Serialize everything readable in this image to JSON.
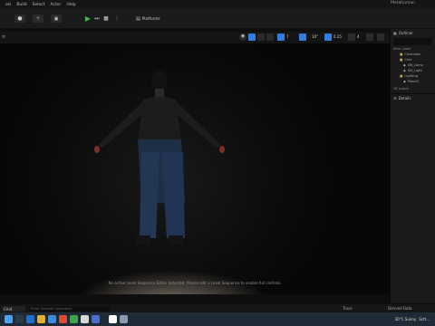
{
  "menu": {
    "items": [
      "ols",
      "Build",
      "Select",
      "Actor",
      "Help"
    ],
    "title": "Metahuman"
  },
  "toolbar": {
    "platforms_label": "Platforms"
  },
  "viewport": {
    "stats": [
      "7",
      "0.25",
      "4"
    ],
    "hint": "No active Level Sequence Editor detected. Please edit a Level Sequence to enable full controls."
  },
  "outliner": {
    "title": "Outliner",
    "column_label": "Item Label",
    "items": [
      "Cinematic",
      "Cine",
      "SM_Lamp",
      "SM_Light",
      "Lighting",
      "Plane3"
    ],
    "actors_count": "28 actors"
  },
  "details": {
    "title": "Details"
  },
  "statusbar": {
    "cmd_label": "Cmd",
    "console_placeholder": "Enter Console Command",
    "trace_label": "Trace",
    "derived_label": "Derived Data"
  },
  "taskbar": {
    "weather": "30°C Sunny",
    "wxtext": "Sctt..."
  },
  "colors": {
    "accent": "#2f7de1",
    "play": "#4caf50",
    "panel": "#1a1a1a"
  }
}
